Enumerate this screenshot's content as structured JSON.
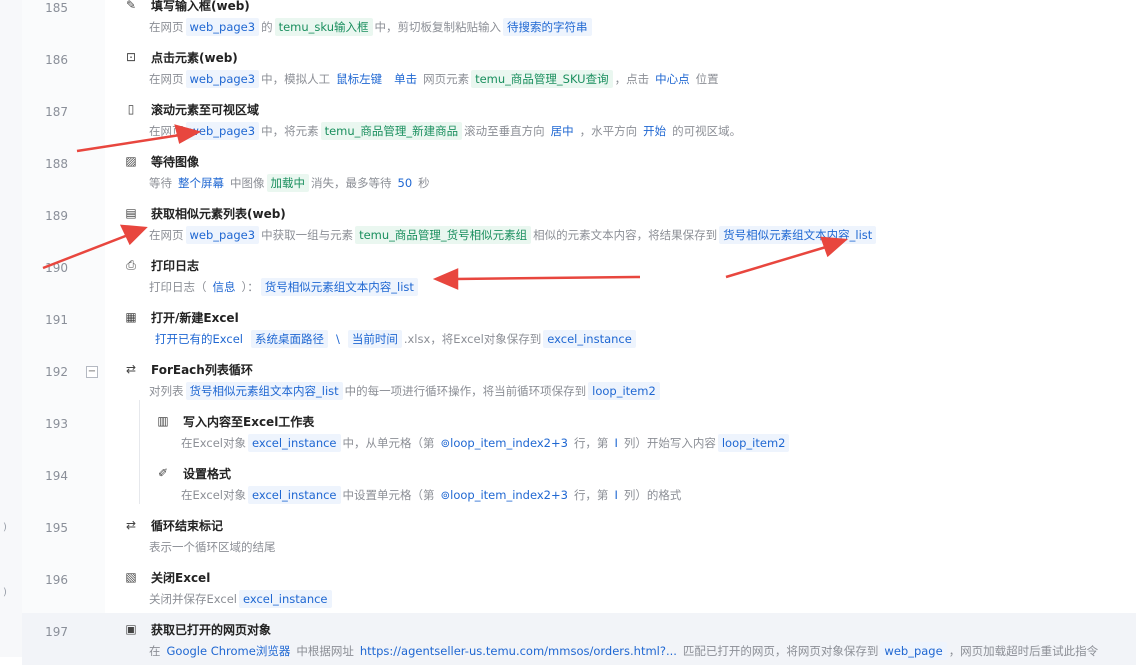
{
  "leftbar": {
    "marks": [
      ")",
      ")"
    ]
  },
  "rows": [
    {
      "num": "185",
      "icon": "input-text-icon",
      "glyph": "✎",
      "title": "填写输入框(web)",
      "desc": [
        {
          "t": "在网页"
        },
        {
          "t": "web_page3",
          "k": "b"
        },
        {
          "t": "的"
        },
        {
          "t": "temu_sku输入框",
          "k": "g"
        },
        {
          "t": "中，剪切板复制粘贴输入"
        },
        {
          "t": "待搜索的字符串",
          "k": "b"
        }
      ]
    },
    {
      "num": "186",
      "icon": "click-element-icon",
      "glyph": "⊡",
      "title": "点击元素(web)",
      "desc": [
        {
          "t": "在网页"
        },
        {
          "t": "web_page3",
          "k": "b"
        },
        {
          "t": "中，模拟人工"
        },
        {
          "t": "鼠标左键",
          "k": "p"
        },
        {
          "t": "单击",
          "k": "p"
        },
        {
          "t": "网页元素"
        },
        {
          "t": "temu_商品管理_SKU查询",
          "k": "g"
        },
        {
          "t": "，点击"
        },
        {
          "t": "中心点",
          "k": "p"
        },
        {
          "t": "位置"
        }
      ]
    },
    {
      "num": "187",
      "icon": "scroll-element-icon",
      "glyph": "▯",
      "title": "滚动元素至可视区域",
      "desc": [
        {
          "t": "在网页"
        },
        {
          "t": "web_page3",
          "k": "b"
        },
        {
          "t": "中，将元素"
        },
        {
          "t": "temu_商品管理_新建商品",
          "k": "g"
        },
        {
          "t": "滚动至垂直方向"
        },
        {
          "t": "居中",
          "k": "p"
        },
        {
          "t": "，水平方向"
        },
        {
          "t": "开始",
          "k": "p"
        },
        {
          "t": "的可视区域。"
        }
      ]
    },
    {
      "num": "188",
      "icon": "wait-image-icon",
      "glyph": "▨",
      "title": "等待图像",
      "desc": [
        {
          "t": "等待"
        },
        {
          "t": "整个屏幕",
          "k": "p"
        },
        {
          "t": "中图像"
        },
        {
          "t": "加载中",
          "k": "g"
        },
        {
          "t": "消失，最多等待"
        },
        {
          "t": "50",
          "k": "p"
        },
        {
          "t": "秒"
        }
      ]
    },
    {
      "num": "189",
      "icon": "similar-elements-icon",
      "glyph": "▤",
      "title": "获取相似元素列表(web)",
      "desc": [
        {
          "t": "在网页"
        },
        {
          "t": "web_page3",
          "k": "b"
        },
        {
          "t": "中获取一组与元素"
        },
        {
          "t": "temu_商品管理_货号相似元素组",
          "k": "g"
        },
        {
          "t": "相似的元素文本内容，将结果保存到"
        },
        {
          "t": "货号相似元素组文本内容_list",
          "k": "b"
        }
      ]
    },
    {
      "num": "190",
      "icon": "print-log-icon",
      "glyph": "⎙",
      "title": "打印日志",
      "desc": [
        {
          "t": "打印日志（"
        },
        {
          "t": "信息",
          "k": "p"
        },
        {
          "t": "）："
        },
        {
          "t": "货号相似元素组文本内容_list",
          "k": "b"
        }
      ]
    },
    {
      "num": "191",
      "icon": "excel-open-icon",
      "glyph": "▦",
      "title": "打开/新建Excel",
      "desc": [
        {
          "t": "打开已有的Excel",
          "k": "p"
        },
        {
          "t": "系统桌面路径",
          "k": "b"
        },
        {
          "t": "\\",
          "k": "p"
        },
        {
          "t": "当前时间",
          "k": "b"
        },
        {
          "t": ".xlsx"
        },
        {
          "t": "，将Excel对象保存到"
        },
        {
          "t": "excel_instance",
          "k": "b"
        }
      ]
    },
    {
      "num": "192",
      "icon": "foreach-loop-icon",
      "glyph": "⇄",
      "title": "ForEach列表循环",
      "collapse": "−",
      "desc": [
        {
          "t": "对列表"
        },
        {
          "t": "货号相似元素组文本内容_list",
          "k": "b"
        },
        {
          "t": "中的每一项进行循环操作，将当前循环项保存到"
        },
        {
          "t": "loop_item2",
          "k": "b"
        }
      ]
    },
    {
      "num": "193",
      "icon": "excel-write-icon",
      "glyph": "▥",
      "title": "写入内容至Excel工作表",
      "indent": true,
      "desc": [
        {
          "t": "在Excel对象"
        },
        {
          "t": "excel_instance",
          "k": "b"
        },
        {
          "t": "中，从单元格（第"
        },
        {
          "t": "⊚loop_item_index2+3",
          "k": "p"
        },
        {
          "t": "行，第"
        },
        {
          "t": "I",
          "k": "p"
        },
        {
          "t": "列）开始写入内容"
        },
        {
          "t": "loop_item2",
          "k": "b"
        }
      ]
    },
    {
      "num": "194",
      "icon": "format-icon",
      "glyph": "✐",
      "title": "设置格式",
      "indent": true,
      "desc": [
        {
          "t": "在Excel对象"
        },
        {
          "t": "excel_instance",
          "k": "b"
        },
        {
          "t": "中设置单元格（第"
        },
        {
          "t": "⊚loop_item_index2+3",
          "k": "p"
        },
        {
          "t": "行，第"
        },
        {
          "t": "I",
          "k": "p"
        },
        {
          "t": "列）的格式"
        }
      ]
    },
    {
      "num": "195",
      "icon": "loop-end-icon",
      "glyph": "⇄",
      "title": "循环结束标记",
      "desc": [
        {
          "t": "表示一个循环区域的结尾"
        }
      ]
    },
    {
      "num": "196",
      "icon": "excel-close-icon",
      "glyph": "▧",
      "title": "关闭Excel",
      "desc": [
        {
          "t": "关闭并保存Excel"
        },
        {
          "t": "excel_instance",
          "k": "b"
        }
      ]
    },
    {
      "num": "197",
      "icon": "browser-page-icon",
      "glyph": "▣",
      "title": "获取已打开的网页对象",
      "selected": true,
      "desc": [
        {
          "t": "在"
        },
        {
          "t": "Google Chrome浏览器",
          "k": "p"
        },
        {
          "t": "中根据网址"
        },
        {
          "t": "https://agentseller-us.temu.com/mmsos/orders.html?...",
          "k": "p"
        },
        {
          "t": "匹配已打开的网页，将网页对象保存到"
        },
        {
          "t": "web_page",
          "k": "b"
        },
        {
          "t": "，网页加载超时后重试此指令"
        }
      ]
    }
  ],
  "colors": {
    "annotation_arrow": "#e8463e",
    "token_blue": "#1f67d2",
    "token_green": "#1a8f5e"
  }
}
